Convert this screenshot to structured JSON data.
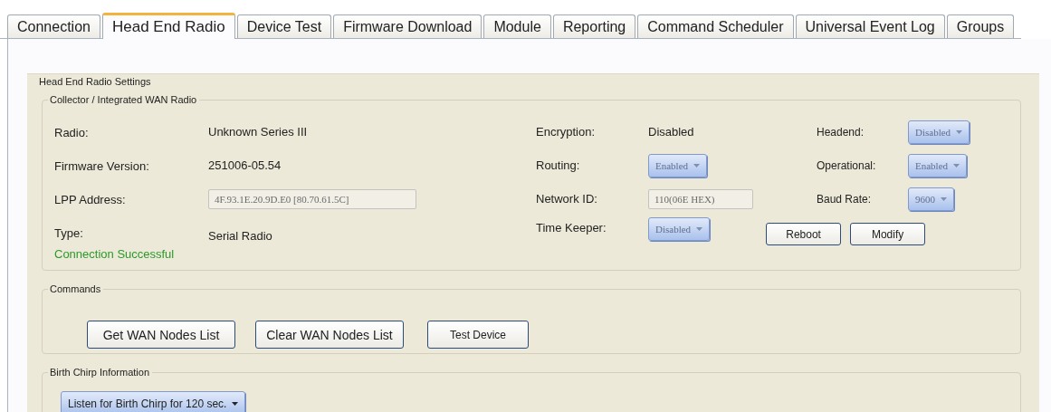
{
  "tabs": [
    {
      "label": "Connection",
      "selected": false
    },
    {
      "label": "Head End Radio",
      "selected": true
    },
    {
      "label": "Device Test",
      "selected": false
    },
    {
      "label": "Firmware Download",
      "selected": false
    },
    {
      "label": "Module",
      "selected": false
    },
    {
      "label": "Reporting",
      "selected": false
    },
    {
      "label": "Command Scheduler",
      "selected": false
    },
    {
      "label": "Universal Event Log",
      "selected": false
    },
    {
      "label": "Groups",
      "selected": false
    }
  ],
  "settings": {
    "title": "Head End Radio Settings",
    "collector": {
      "title": "Collector / Integrated WAN Radio",
      "rows": [
        {
          "cells": [
            {
              "label": "Radio:",
              "kind": "text",
              "value": "Unknown Series III"
            },
            {
              "label": "Encryption:",
              "kind": "text",
              "value": "Disabled"
            },
            {
              "label": "Headend:",
              "kind": "dropdown",
              "value": "Disabled",
              "disabled": true
            }
          ]
        },
        {
          "cells": [
            {
              "label": "Firmware Version:",
              "kind": "text",
              "value": "251006-05.54"
            },
            {
              "label": "Routing:",
              "kind": "dropdown",
              "value": "Enabled",
              "disabled": true
            },
            {
              "label": "Operational:",
              "kind": "dropdown",
              "value": "Enabled",
              "disabled": true
            }
          ]
        },
        {
          "cells": [
            {
              "label": "LPP Address:",
              "kind": "input",
              "value": "4F.93.1E.20.9D.E0 [80.70.61.5C]",
              "disabled": true
            },
            {
              "label": "Network ID:",
              "kind": "input",
              "value": "110(06E HEX)",
              "disabled": true
            },
            {
              "label": "Baud Rate:",
              "kind": "dropdown",
              "value": "9600",
              "disabled": true
            }
          ]
        },
        {
          "cells": [
            {
              "label": "Type:",
              "kind": "text",
              "value": "Serial Radio"
            },
            {
              "label": "Time Keeper:",
              "kind": "dropdown",
              "value": "Disabled",
              "disabled": true
            }
          ]
        }
      ],
      "status": "Connection Successful",
      "buttons": [
        "Reboot",
        "Modify"
      ]
    },
    "commands": {
      "title": "Commands",
      "buttons": [
        "Get WAN Nodes List",
        "Clear WAN Nodes List",
        "Test Device"
      ]
    },
    "birth_chirp": {
      "title": "Birth Chirp Information",
      "dropdown": {
        "value": "Listen for Birth Chirp for 120 sec.",
        "disabled": false
      }
    }
  }
}
